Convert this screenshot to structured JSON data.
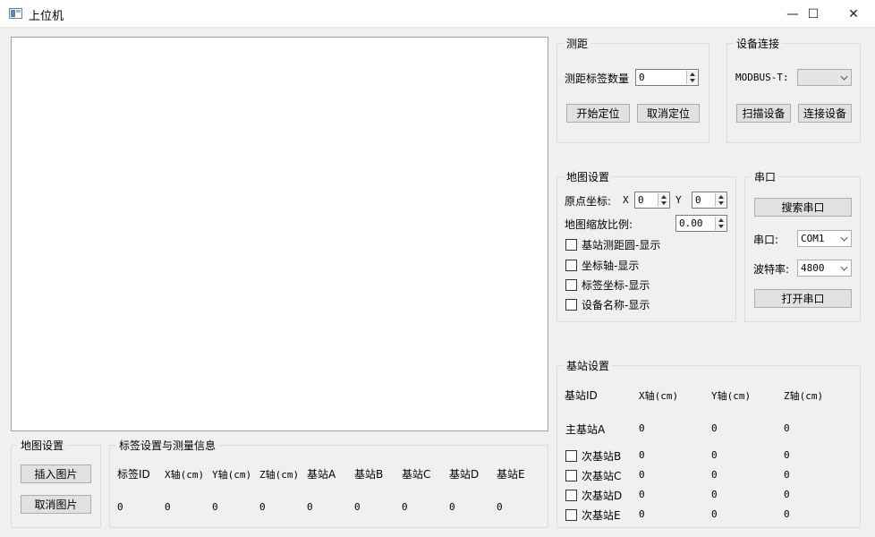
{
  "window": {
    "title": "上位机",
    "minimize": "—",
    "maximize": "☐",
    "close": "✕"
  },
  "ranging": {
    "title": "测距",
    "tag_count_label": "测距标签数量",
    "tag_count_value": "0",
    "start_button": "开始定位",
    "cancel_button": "取消定位"
  },
  "device": {
    "title": "设备连接",
    "modbus_label": "MODBUS-T:",
    "modbus_value": "",
    "scan_button": "扫描设备",
    "connect_button": "连接设备"
  },
  "map_settings": {
    "title": "地图设置",
    "origin_label": "原点坐标:",
    "x_label": "X",
    "x_value": "0",
    "y_label": "Y",
    "y_value": "0",
    "scale_label": "地图缩放比例:",
    "scale_value": "0.00",
    "checkboxes": [
      "基站测距圆-显示",
      "坐标轴-显示",
      "标签坐标-显示",
      "设备名称-显示"
    ]
  },
  "serial": {
    "title": "串口",
    "search_button": "搜索串口",
    "port_label": "串口:",
    "port_value": "COM1",
    "baud_label": "波特率:",
    "baud_value": "4800",
    "open_button": "打开串口"
  },
  "base_station": {
    "title": "基站设置",
    "headers": [
      "基站ID",
      "X轴(cm)",
      "Y轴(cm)",
      "Z轴(cm)"
    ],
    "rows": [
      {
        "name": "主基站A",
        "x": "0",
        "y": "0",
        "z": "0"
      },
      {
        "name": "次基站B",
        "x": "0",
        "y": "0",
        "z": "0"
      },
      {
        "name": "次基站C",
        "x": "0",
        "y": "0",
        "z": "0"
      },
      {
        "name": "次基站D",
        "x": "0",
        "y": "0",
        "z": "0"
      },
      {
        "name": "次基站E",
        "x": "0",
        "y": "0",
        "z": "0"
      }
    ]
  },
  "map_image": {
    "title": "地图设置",
    "insert_button": "插入图片",
    "cancel_button": "取消图片"
  },
  "tag_info": {
    "title": "标签设置与测量信息",
    "headers": [
      "标签ID",
      "X轴(cm)",
      "Y轴(cm)",
      "Z轴(cm)",
      "基站A",
      "基站B",
      "基站C",
      "基站D",
      "基站E"
    ],
    "values": [
      "0",
      "0",
      "0",
      "0",
      "0",
      "0",
      "0",
      "0",
      "0"
    ]
  }
}
